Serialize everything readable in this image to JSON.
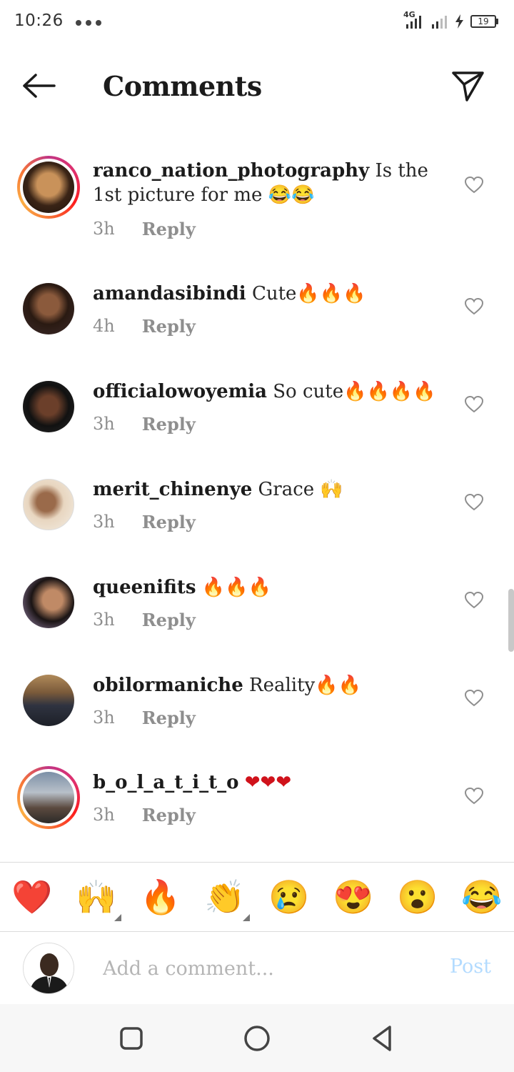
{
  "status_bar": {
    "time": "10:26",
    "network": "4G",
    "battery": "19"
  },
  "header": {
    "title": "Comments",
    "back_icon": "arrow-left-icon",
    "send_icon": "paper-plane-icon"
  },
  "comments": [
    {
      "username": "ranco_nation_photography",
      "text": "Is the 1st picture for me 😂😂",
      "time": "3h",
      "reply": "Reply",
      "has_story_ring": true
    },
    {
      "username": "amandasibindi",
      "text": "Cute🔥🔥🔥",
      "time": "4h",
      "reply": "Reply",
      "has_story_ring": false
    },
    {
      "username": "officialowoyemia",
      "text": "So cute🔥🔥🔥🔥",
      "time": "3h",
      "reply": "Reply",
      "has_story_ring": false
    },
    {
      "username": "merit_chinenye",
      "text": "Grace 🙌",
      "time": "3h",
      "reply": "Reply",
      "has_story_ring": false
    },
    {
      "username": "queenifits",
      "text": "🔥🔥🔥",
      "time": "3h",
      "reply": "Reply",
      "has_story_ring": false
    },
    {
      "username": "obilormaniche",
      "text": "Reality🔥🔥",
      "time": "3h",
      "reply": "Reply",
      "has_story_ring": false
    },
    {
      "username": "b_o_l_a_t_i_t_o",
      "text": "❤❤❤",
      "time": "3h",
      "reply": "Reply",
      "has_story_ring": true
    }
  ],
  "emoji_bar": [
    "❤️",
    "🙌",
    "🔥",
    "👏",
    "😢",
    "😍",
    "😮",
    "😂"
  ],
  "composer": {
    "placeholder": "Add a comment...",
    "post_label": "Post"
  },
  "colors": {
    "text": "#262626",
    "meta": "#8e8e8e",
    "post_disabled": "#b3dbff",
    "story_ring": "#e1306c"
  }
}
